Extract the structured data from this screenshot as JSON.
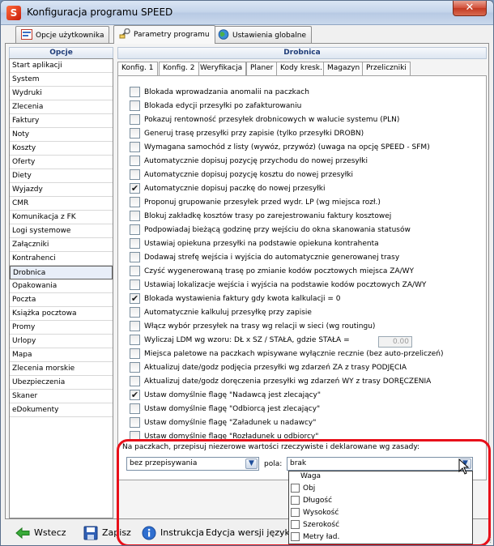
{
  "window": {
    "title": "Konfiguracja programu SPEED",
    "close_glyph": "✕"
  },
  "main_tabs": [
    {
      "label": "Opcje użytkownika",
      "icon": "user-options-icon"
    },
    {
      "label": "Parametry programu",
      "icon": "wrench-icon"
    },
    {
      "label": "Ustawienia globalne",
      "icon": "globe-icon"
    }
  ],
  "left_header": "Opcje",
  "right_header": "Drobnica",
  "left_items": [
    "Start aplikacji",
    "System",
    "Wydruki",
    "Zlecenia",
    "Faktury",
    "Noty",
    "Koszty",
    "Oferty",
    "Diety",
    "Wyjazdy",
    "CMR",
    "Komunikacja z FK",
    "Logi systemowe",
    "Załączniki",
    "Kontrahenci",
    "Drobnica",
    "Opakowania",
    "Poczta",
    "Książka pocztowa",
    "Promy",
    "Urlopy",
    "Mapa",
    "Zlecenia morskie",
    "Ubezpieczenia",
    "Skaner",
    "eDokumenty"
  ],
  "left_selected_index": 15,
  "sub_tabs": [
    "Konfig. 1",
    "Konfig. 2",
    "Weryfikacja",
    "Planer",
    "Kody kresk.",
    "Magazyn",
    "Przeliczniki"
  ],
  "sub_tab_active_index": 1,
  "check_glyph": "✔",
  "options": [
    {
      "label": "Blokada wprowadzania anomalii na paczkach",
      "checked": false
    },
    {
      "label": "Blokada edycji przesyłki po zafakturowaniu",
      "checked": false
    },
    {
      "label": "Pokazuj rentowność przesyłek drobnicowych w walucie systemu (PLN)",
      "checked": false
    },
    {
      "label": "Generuj trasę przesyłki przy zapisie (tylko przesyłki DROBN)",
      "checked": false
    },
    {
      "label": "Wymagana samochód z listy (wywóz, przywóz) (uwaga na opcję SPEED - SFM)",
      "checked": false
    },
    {
      "label": "Automatycznie dopisuj pozycję przychodu do nowej przesyłki",
      "checked": false
    },
    {
      "label": "Automatycznie dopisuj pozycję kosztu do nowej przesyłki",
      "checked": false
    },
    {
      "label": "Automatycznie dopisuj paczkę do nowej przesyłki",
      "checked": true
    },
    {
      "label": "Proponuj grupowanie przesyłek przed wydr. LP (wg miejsca rozł.)",
      "checked": false
    },
    {
      "label": "Blokuj zakładkę kosztów trasy po zarejestrowaniu faktury kosztowej",
      "checked": false
    },
    {
      "label": "Podpowiadaj bieżącą godzinę przy wejściu do okna skanowania statusów",
      "checked": false
    },
    {
      "label": "Ustawiaj opiekuna przesyłki na podstawie opiekuna kontrahenta",
      "checked": false
    },
    {
      "label": "Dodawaj strefę wejścia i wyjścia do automatycznie generowanej trasy",
      "checked": false
    },
    {
      "label": "Czyść wygenerowaną trasę po zmianie kodów pocztowych miejsca ZA/WY",
      "checked": false
    },
    {
      "label": "Ustawiaj lokalizacje wejścia i wyjścia na podstawie kodów pocztowych ZA/WY",
      "checked": false
    },
    {
      "label": "Blokada wystawienia faktury gdy kwota kalkulacji = 0",
      "checked": true
    },
    {
      "label": "Automatycznie kalkuluj przesyłkę przy zapisie",
      "checked": false
    },
    {
      "label": "Włącz wybór przesyłek na trasy wg relacji w sieci (wg routingu)",
      "checked": false
    },
    {
      "label": "Wyliczaj LDM wg wzoru: DŁ x SZ / STAŁA, gdzie STAŁA =",
      "checked": false,
      "input_value": "0.00"
    },
    {
      "label": "Miejsca paletowe na paczkach wpisywane wyłącznie recznie (bez auto-przeliczeń)",
      "checked": false
    },
    {
      "label": "Aktualizuj date/godz podjęcia przesyłki wg zdarzeń ZA z trasy PODJĘCIA",
      "checked": false
    },
    {
      "label": "Aktualizuj date/godz doręczenia przesyłki wg zdarzeń WY z trasy DORĘCZENIA",
      "checked": false
    },
    {
      "label": "Ustaw domyślnie flagę \"Nadawcą jest zlecający\"",
      "checked": true
    },
    {
      "label": "Ustaw domyślnie flagę \"Odbiorcą jest zlecający\"",
      "checked": false
    },
    {
      "label": "Ustaw domyślnie flagę \"Załadunek u nadawcy\"",
      "checked": false
    },
    {
      "label": "Ustaw domyślnie flagę \"Rozładunek u odbiorcy\"",
      "checked": false
    }
  ],
  "bottom": {
    "note": "Na paczkach, przepisuj niezerowe wartości rzeczywiste i deklarowane wg zasady:",
    "rule_value": "bez przepisywania",
    "pola_label": "pola:",
    "pola_value": "brak",
    "dropdown_items": [
      "Waga",
      "Obj",
      "Długość",
      "Wysokość",
      "Szerokość",
      "Metry ład."
    ]
  },
  "footer": {
    "back": "Wstecz",
    "save": "Zapisz",
    "instructions": "Instrukcja",
    "language": "Edycja wersji językow"
  },
  "colors": {
    "accent": "#1e3c78",
    "highlight": "#e8101a"
  }
}
